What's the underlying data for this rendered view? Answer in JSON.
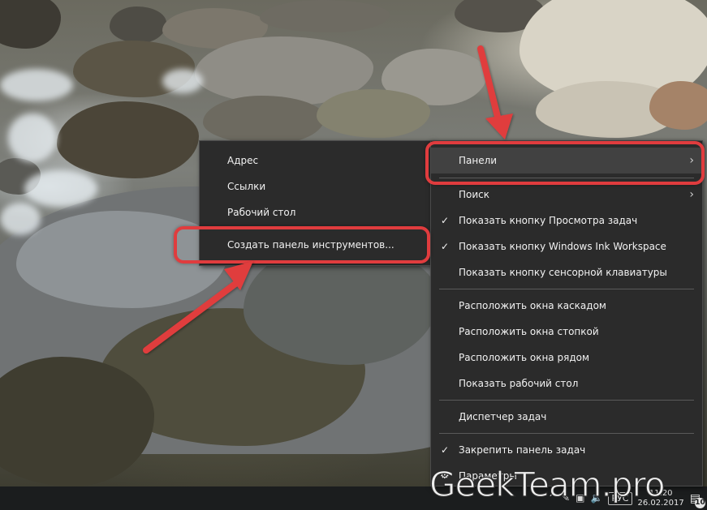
{
  "submenu": {
    "items": [
      {
        "label": "Адрес"
      },
      {
        "label": "Ссылки"
      },
      {
        "label": "Рабочий стол"
      },
      {
        "label": "Создать панель инструментов..."
      }
    ]
  },
  "taskbar_menu": {
    "panels": "Панели",
    "search": "Поиск",
    "show_task_view": "Показать кнопку Просмотра задач",
    "show_ink": "Показать кнопку Windows Ink Workspace",
    "show_keyboard": "Показать кнопку сенсорной клавиатуры",
    "cascade": "Расположить окна каскадом",
    "stack": "Расположить окна стопкой",
    "side_by_side": "Расположить окна рядом",
    "show_desktop": "Показать рабочий стол",
    "task_manager": "Диспетчер задач",
    "lock_taskbar": "Закрепить панель задач",
    "settings": "Параметры"
  },
  "taskbar": {
    "language": "РУС",
    "time": "11:20",
    "date": "26.02.2017",
    "notification_count": "10"
  },
  "watermark": "GeekTeam.pro",
  "icons": {
    "check": "check-icon",
    "chevron": "chevron-right-icon",
    "gear": "gear-icon"
  },
  "colors": {
    "menu_bg": "#2b2b2b",
    "menu_highlight": "#414141",
    "annotation_red": "#e03c3e",
    "taskbar_bg": "#1b1d1e"
  }
}
